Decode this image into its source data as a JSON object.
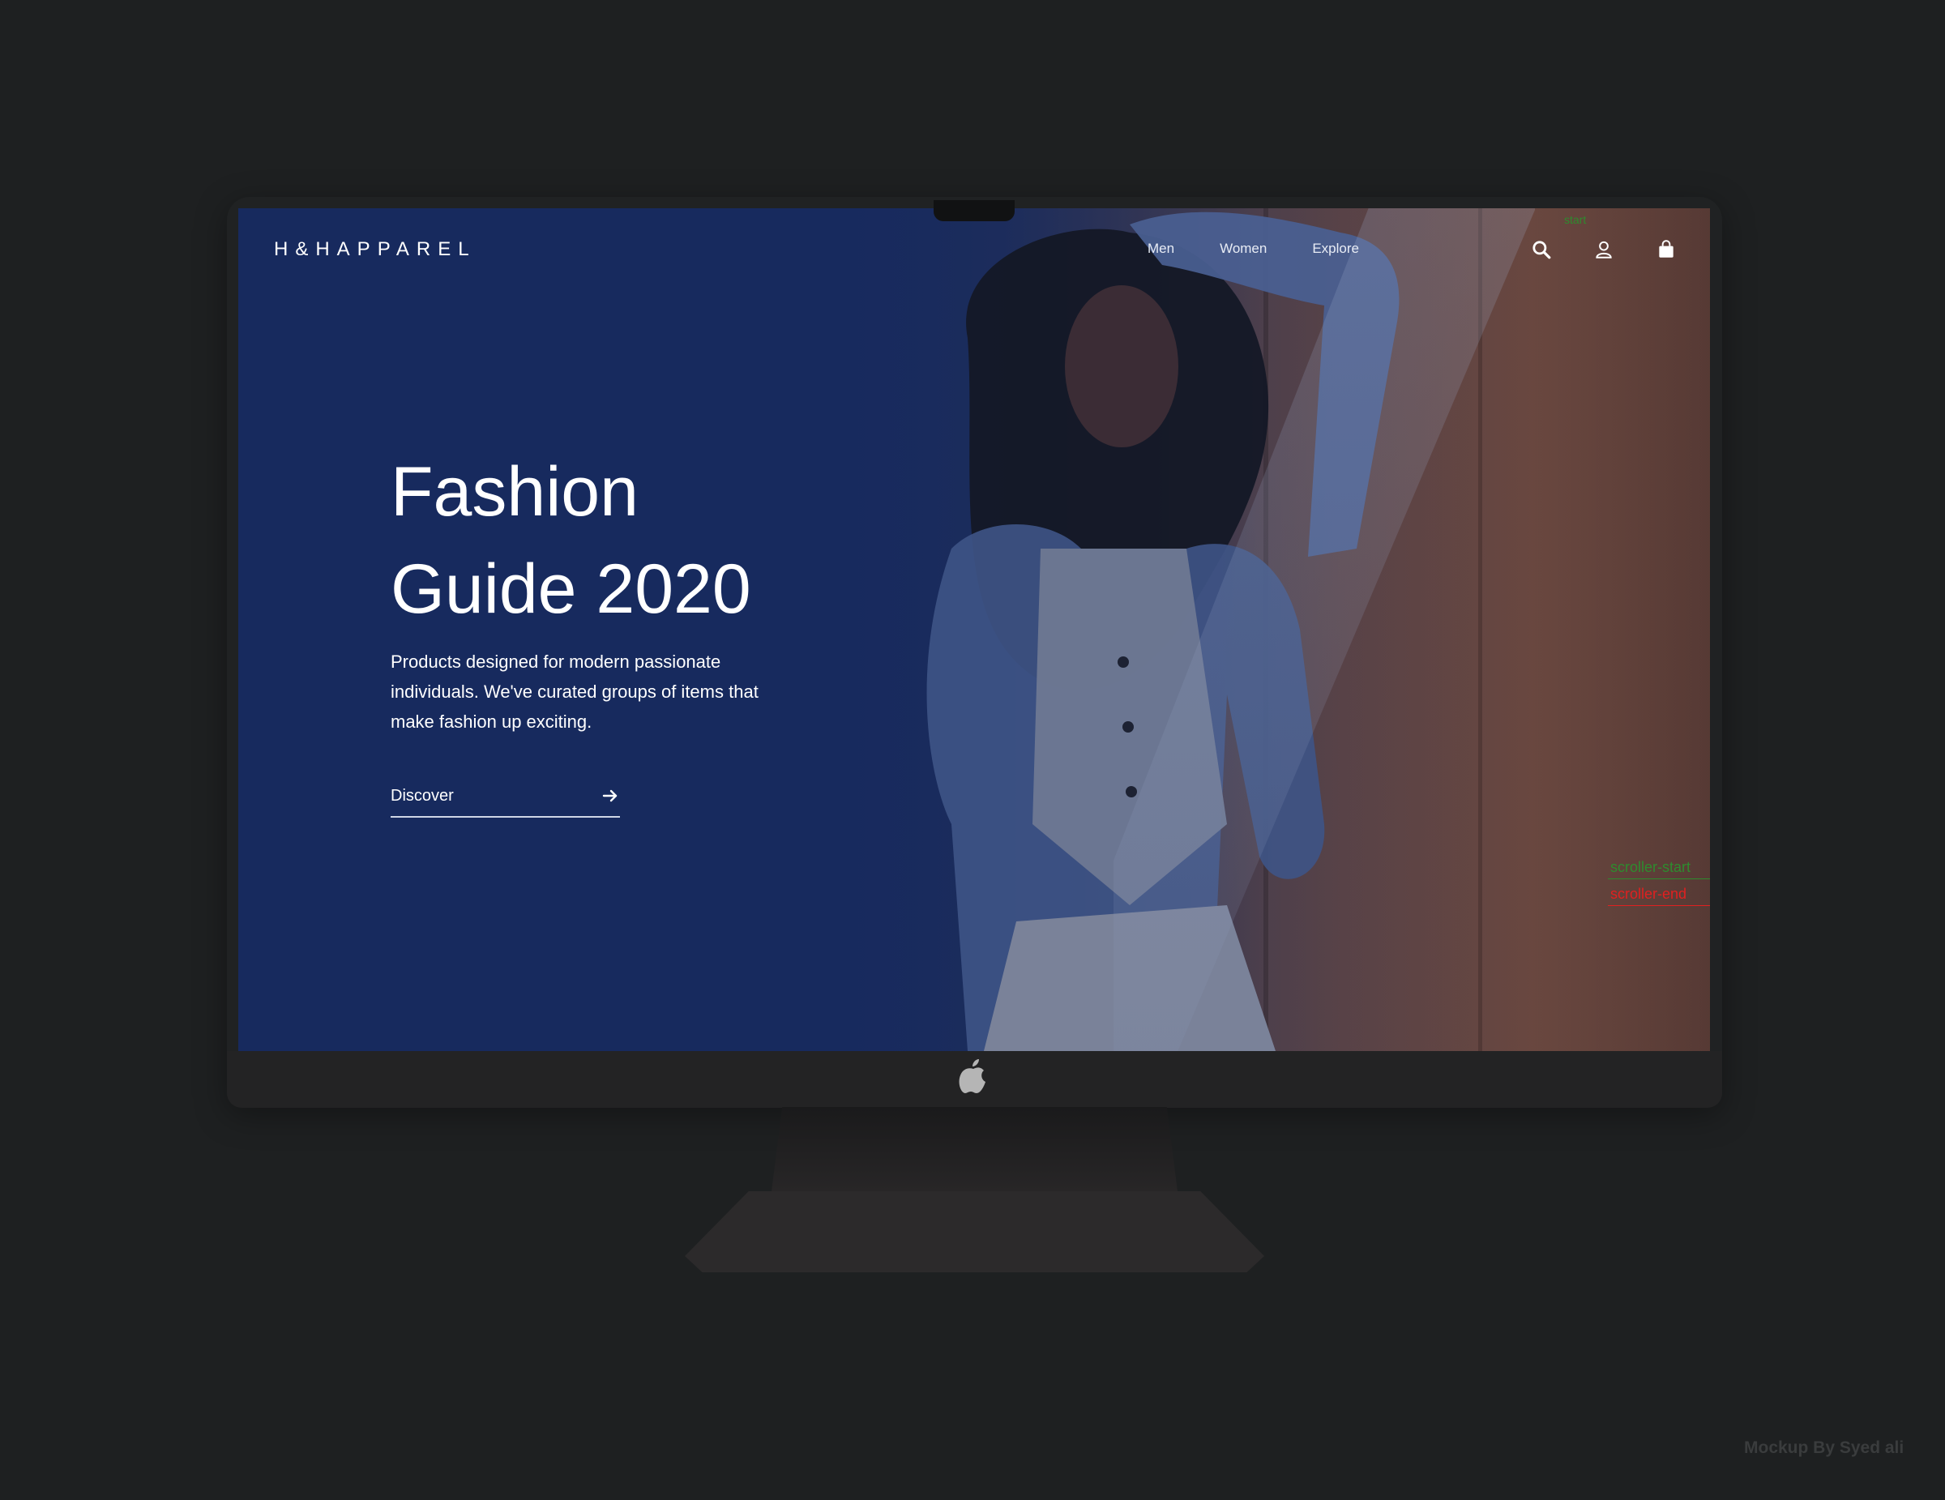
{
  "brand": {
    "name": "H&HAPPAREL"
  },
  "nav": {
    "links": [
      {
        "label": "Men"
      },
      {
        "label": "Women"
      },
      {
        "label": "Explore"
      }
    ],
    "icons": [
      "search-icon",
      "user-icon",
      "shopping-bag-icon"
    ]
  },
  "hero": {
    "title_line1": "Fashion",
    "title_line2": "Guide 2020",
    "body": "Products designed for modern passionate individuals. We've curated groups of items that make fashion up exciting.",
    "cta_label": "Discover",
    "cta_icon": "arrow-right-icon"
  },
  "debug_markers": {
    "start": "start",
    "scroller_start": "scroller-start",
    "scroller_end": "scroller-end"
  },
  "watermark": "Mockup By Syed ali",
  "colors": {
    "hero_bg": "#172a5e",
    "page_bg": "#1e2021",
    "debug_green": "#2e8b2e",
    "debug_red": "#e02020"
  }
}
